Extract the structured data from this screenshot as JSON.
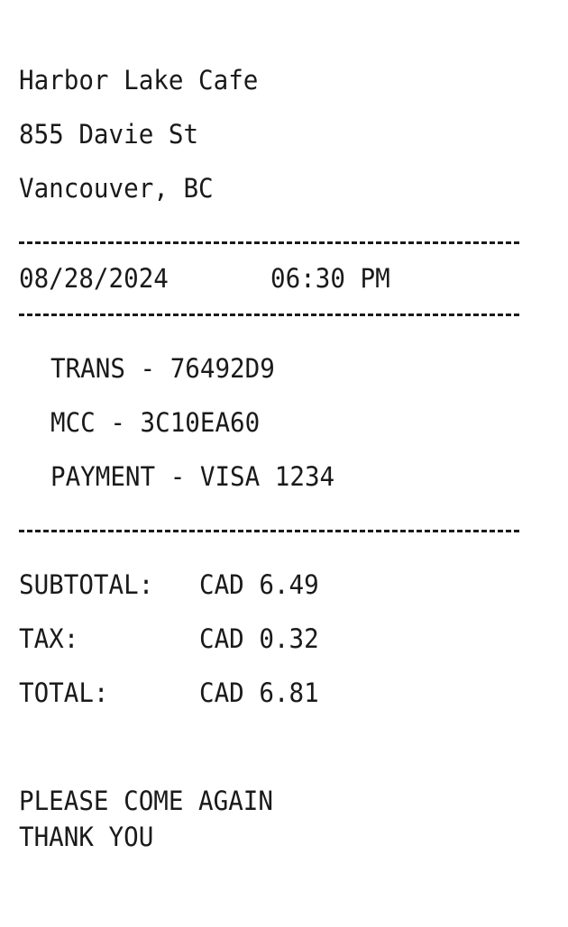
{
  "merchant": {
    "name": "Harbor Lake Cafe",
    "address": "855 Davie St",
    "city": "Vancouver, BC"
  },
  "datetime": {
    "date": "08/28/2024",
    "time": "06:30 PM"
  },
  "transaction": {
    "trans": "TRANS - 76492D9",
    "mcc": "MCC - 3C10EA60",
    "payment": "PAYMENT - VISA 1234"
  },
  "totals": {
    "subtotal_label": "SUBTOTAL:",
    "subtotal_value": "CAD 6.49",
    "tax_label": "TAX:",
    "tax_value": "CAD 0.32",
    "total_label": "TOTAL:",
    "total_value": "CAD 6.81"
  },
  "footer": {
    "line1": "PLEASE COME AGAIN",
    "line2": "THANK YOU"
  }
}
